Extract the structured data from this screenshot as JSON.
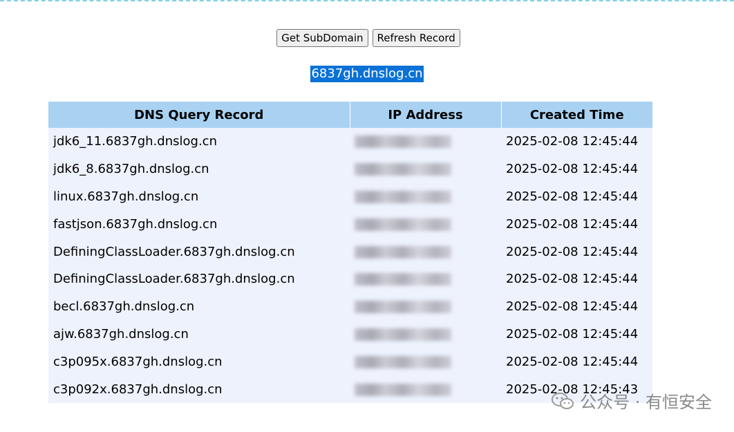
{
  "toolbar": {
    "get_subdomain_label": "Get SubDomain",
    "refresh_record_label": "Refresh Record"
  },
  "subdomain": "6837gh.dnslog.cn",
  "table": {
    "headers": [
      "DNS Query Record",
      "IP Address",
      "Created Time"
    ],
    "rows": [
      {
        "query": "jdk6_11.6837gh.dnslog.cn",
        "ip": "",
        "time": "2025-02-08 12:45:44"
      },
      {
        "query": "jdk6_8.6837gh.dnslog.cn",
        "ip": "",
        "time": "2025-02-08 12:45:44"
      },
      {
        "query": "linux.6837gh.dnslog.cn",
        "ip": "",
        "time": "2025-02-08 12:45:44"
      },
      {
        "query": "fastjson.6837gh.dnslog.cn",
        "ip": "",
        "time": "2025-02-08 12:45:44"
      },
      {
        "query": "DefiningClassLoader.6837gh.dnslog.cn",
        "ip": "",
        "time": "2025-02-08 12:45:44"
      },
      {
        "query": "DefiningClassLoader.6837gh.dnslog.cn",
        "ip": "",
        "time": "2025-02-08 12:45:44"
      },
      {
        "query": "becl.6837gh.dnslog.cn",
        "ip": "",
        "time": "2025-02-08 12:45:44"
      },
      {
        "query": "ajw.6837gh.dnslog.cn",
        "ip": "",
        "time": "2025-02-08 12:45:44"
      },
      {
        "query": "c3p095x.6837gh.dnslog.cn",
        "ip": "",
        "time": "2025-02-08 12:45:44"
      },
      {
        "query": "c3p092x.6837gh.dnslog.cn",
        "ip": "",
        "time": "2025-02-08 12:45:43"
      }
    ]
  },
  "watermark": {
    "text": "公众号 · 有恒安全",
    "icon": "wechat-icon"
  },
  "colors": {
    "header_bg": "#a9d2f2",
    "row_bg": "#eef2fd",
    "selection_bg": "#0a72d6",
    "top_dash": "#7fd0e6"
  }
}
